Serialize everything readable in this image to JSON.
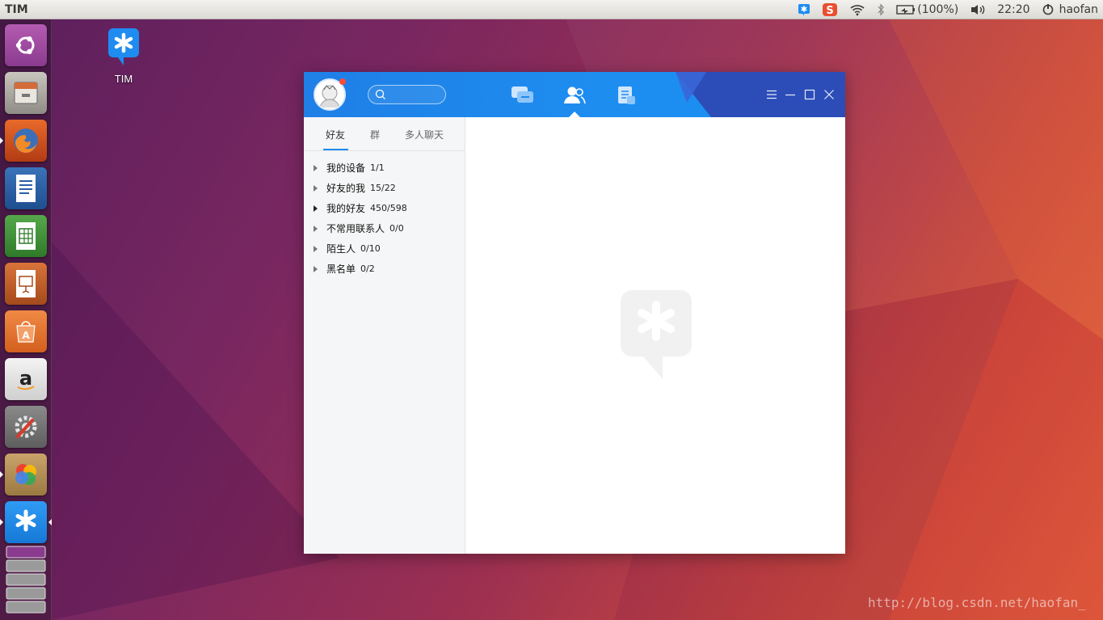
{
  "top_panel": {
    "title": "TIM",
    "battery_text": "(100%)",
    "clock": "22:20",
    "user": "haofan"
  },
  "desktop": {
    "icon_label": "TIM"
  },
  "launcher": {
    "items": [
      "ubuntu-dash-icon",
      "files-icon",
      "firefox-icon",
      "writer-icon",
      "calc-icon",
      "impress-icon",
      "software-center-icon",
      "amazon-icon",
      "system-settings-icon",
      "picasa-icon",
      "tim-icon",
      "workspace-icon"
    ]
  },
  "tim": {
    "search_placeholder": "",
    "subtabs": [
      "好友",
      "群",
      "多人聊天"
    ],
    "groups": [
      {
        "name": "我的设备",
        "count": "1/1"
      },
      {
        "name": "好友的我",
        "count": "15/22"
      },
      {
        "name": "我的好友",
        "count": "450/598"
      },
      {
        "name": "不常用联系人",
        "count": "0/0"
      },
      {
        "name": "陌生人",
        "count": "0/10"
      },
      {
        "name": "黑名单",
        "count": "0/2"
      }
    ],
    "colors": {
      "header": "#1e8cf0",
      "accent": "#168cf0"
    }
  },
  "watermark": "http://blog.csdn.net/haofan_"
}
